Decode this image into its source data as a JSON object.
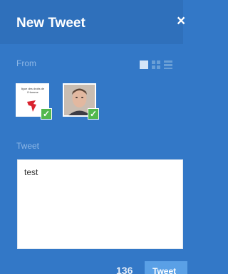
{
  "header": {
    "title": "New Tweet",
    "close_label": "×"
  },
  "from": {
    "label": "From",
    "view_modes": [
      "single-view-icon",
      "grid-view-icon",
      "list-view-icon"
    ],
    "accounts": [
      {
        "name": "logo-account",
        "logo_text": "ligue des droits de l'Homme",
        "selected": true
      },
      {
        "name": "photo-account",
        "selected": true
      }
    ]
  },
  "tweet": {
    "label": "Tweet",
    "text": "test"
  },
  "footer": {
    "counter": "136",
    "button_label": "Tweet"
  },
  "colors": {
    "panel_bg": "#3378c7",
    "header_bg": "#2f70bb",
    "label_color": "#8fb8e6",
    "check_green": "#52b84e",
    "tweet_button_bg": "#5aa0e6"
  }
}
